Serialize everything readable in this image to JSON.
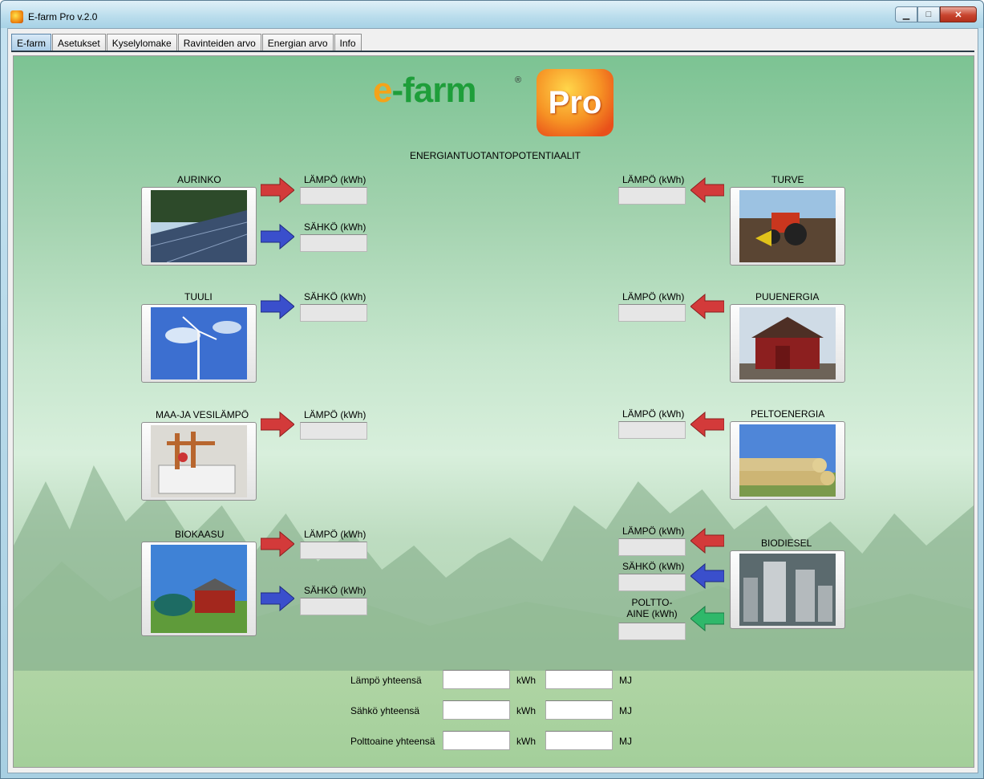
{
  "window": {
    "title": "E-farm Pro v.2.0"
  },
  "tabs": [
    "E-farm",
    "Asetukset",
    "Kyselylomake",
    "Ravinteiden arvo",
    "Energian arvo",
    "Info"
  ],
  "logo": {
    "brand": "-farm",
    "e": "e",
    "reg": "®",
    "pro": "Pro"
  },
  "heading": "ENERGIANTUOTANTOPOTENTIAALIT",
  "sources_left": {
    "aurinko": {
      "name": "AURINKO",
      "out1": "LÄMPÖ (kWh)",
      "out2": "SÄHKÖ (kWh)"
    },
    "tuuli": {
      "name": "TUULI",
      "out1": "SÄHKÖ (kWh)"
    },
    "maavesi": {
      "name": "MAA-JA VESILÄMPÖ",
      "out1": "LÄMPÖ (kWh)"
    },
    "biokaasu": {
      "name": "BIOKAASU",
      "out1": "LÄMPÖ (kWh)",
      "out2": "SÄHKÖ (kWh)"
    }
  },
  "sources_right": {
    "turve": {
      "name": "TURVE",
      "out1": "LÄMPÖ (kWh)"
    },
    "puu": {
      "name": "PUUENERGIA",
      "out1": "LÄMPÖ (kWh)"
    },
    "pelto": {
      "name": "PELTOENERGIA",
      "out1": "LÄMPÖ (kWh)"
    },
    "biodiesel": {
      "name": "BIODIESEL",
      "out1": "LÄMPÖ (kWh)",
      "out2": "SÄHKÖ (kWh)",
      "out3a": "POLTTO-",
      "out3b": "AINE (kWh)"
    }
  },
  "totals": [
    {
      "label": "Lämpö yhteensä",
      "unit1": "kWh",
      "unit2": "MJ",
      "value1": "",
      "value2": ""
    },
    {
      "label": "Sähkö yhteensä",
      "unit1": "kWh",
      "unit2": "MJ",
      "value1": "",
      "value2": ""
    },
    {
      "label": "Polttoaine yhteensä",
      "unit1": "kWh",
      "unit2": "MJ",
      "value1": "",
      "value2": ""
    }
  ],
  "colors": {
    "heat_arrow": "#d33a3a",
    "power_arrow": "#3a4fcc",
    "fuel_arrow": "#2fb86a"
  }
}
